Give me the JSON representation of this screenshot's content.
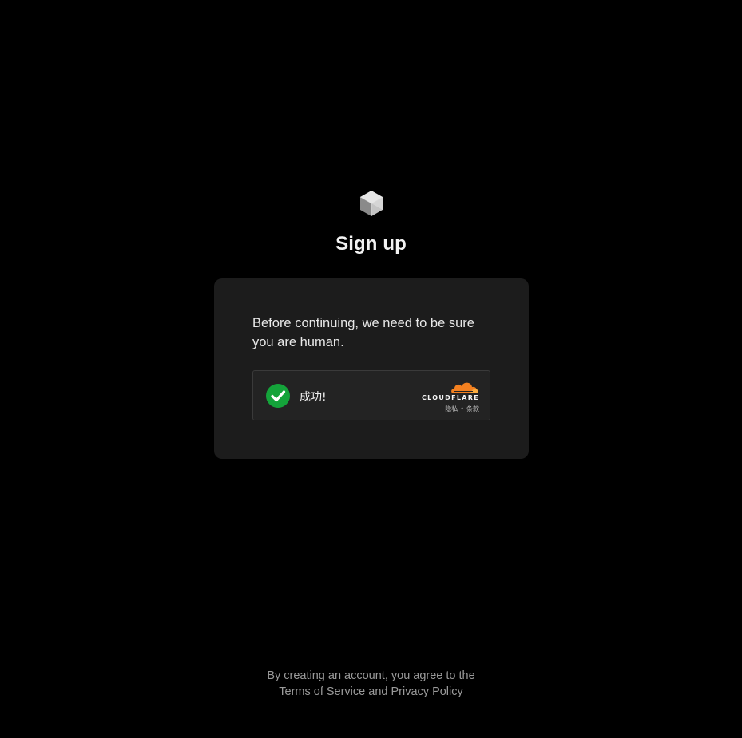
{
  "header": {
    "logo_icon": "cube-icon",
    "title": "Sign up"
  },
  "card": {
    "message": "Before continuing, we need to be sure you are human.",
    "captcha": {
      "status_icon": "check-circle-icon",
      "status_text": "成功!",
      "provider": "CLOUDFLARE",
      "provider_icon": "cloudflare-cloud-icon",
      "privacy_link": "隐私",
      "separator": "•",
      "terms_link": "条款",
      "colors": {
        "success": "#14a33a",
        "cloud_orange": "#f38020",
        "cloud_light": "#fbad41"
      }
    }
  },
  "footer": {
    "line1": "By creating an account, you agree to the",
    "terms_link": "Terms of Service",
    "conjunction": "and",
    "privacy_link": "Privacy Policy"
  }
}
